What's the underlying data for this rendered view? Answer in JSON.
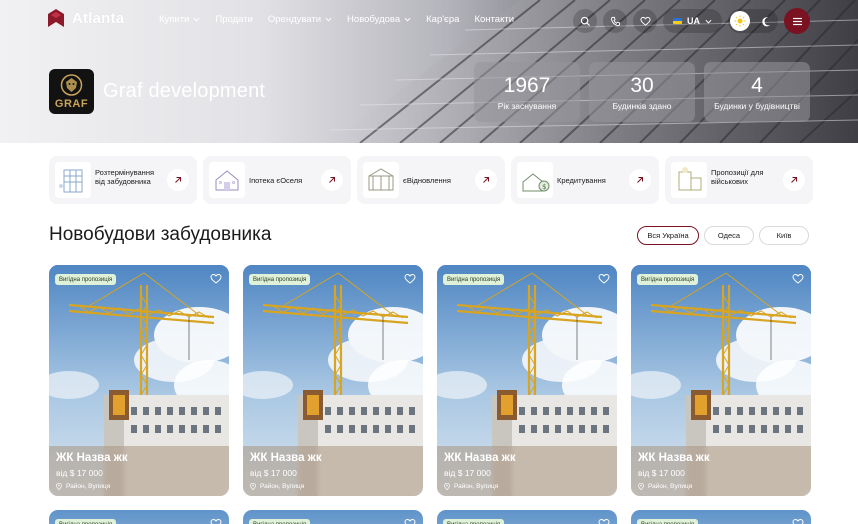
{
  "nav": {
    "brand": "Atlanta",
    "links": [
      {
        "label": "Купити",
        "has_dropdown": true
      },
      {
        "label": "Продати",
        "has_dropdown": false
      },
      {
        "label": "Орендувати",
        "has_dropdown": true
      },
      {
        "label": "Новобудова",
        "has_dropdown": true
      },
      {
        "label": "Кар'єра",
        "has_dropdown": false
      },
      {
        "label": "Контакти",
        "has_dropdown": false
      }
    ],
    "language": "UA",
    "icons": [
      "search-icon",
      "phone-icon",
      "heart-icon",
      "sun-icon",
      "moon-icon",
      "menu-icon"
    ],
    "accent_color": "#7a1221"
  },
  "developer": {
    "logo_text": "GRAF",
    "name": "Graf development",
    "stats": [
      {
        "value": "1967",
        "label": "Рік заснування"
      },
      {
        "value": "30",
        "label": "Будинків здано"
      },
      {
        "value": "4",
        "label": "Будинки у будівництві"
      }
    ]
  },
  "services": [
    {
      "label": "Розтермінування від забудовника"
    },
    {
      "label": "Іпотека єОселя"
    },
    {
      "label": "єВідновлення"
    },
    {
      "label": "Кредитування"
    },
    {
      "label": "Пропозиції для військових"
    }
  ],
  "section": {
    "title": "Новобудови забудовника",
    "filters": [
      {
        "label": "Вся Україна",
        "active": true
      },
      {
        "label": "Одеса",
        "active": false
      },
      {
        "label": "Київ",
        "active": false
      }
    ]
  },
  "listings": [
    {
      "badge": "Вигідна пропозиція",
      "title": "ЖК Назва жк",
      "price": "від $ 17 000",
      "location": "Район, Вулиця"
    },
    {
      "badge": "Вигідна пропозиція",
      "title": "ЖК Назва жк",
      "price": "від $ 17 000",
      "location": "Район, Вулиця"
    },
    {
      "badge": "Вигідна пропозиція",
      "title": "ЖК Назва жк",
      "price": "від $ 17 000",
      "location": "Район, Вулиця"
    },
    {
      "badge": "Вигідна пропозиція",
      "title": "ЖК Назва жк",
      "price": "від $ 17 000",
      "location": "Район, Вулиця"
    }
  ],
  "listings_row2": [
    {
      "badge": "Вигідна пропозиція"
    },
    {
      "badge": "Вигідна пропозиція"
    },
    {
      "badge": "Вигідна пропозиція"
    },
    {
      "badge": "Вигідна пропозиція"
    }
  ]
}
